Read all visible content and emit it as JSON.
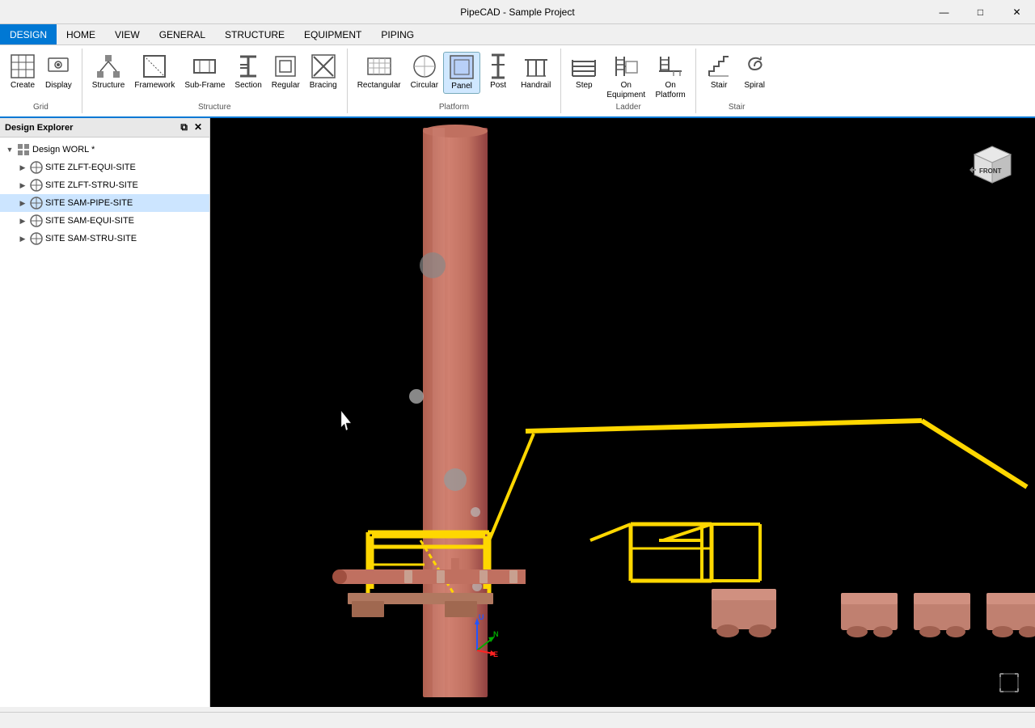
{
  "app": {
    "title": "PipeCAD - Sample Project"
  },
  "window_controls": {
    "minimize": "—",
    "maximize": "□",
    "close": "✕"
  },
  "menu_bar": {
    "items": [
      {
        "id": "design",
        "label": "DESIGN",
        "active": true
      },
      {
        "id": "home",
        "label": "HOME"
      },
      {
        "id": "view",
        "label": "VIEW"
      },
      {
        "id": "general",
        "label": "GENERAL"
      },
      {
        "id": "structure",
        "label": "STRUCTURE"
      },
      {
        "id": "equipment",
        "label": "EQUIPMENT"
      },
      {
        "id": "piping",
        "label": "PIPING"
      }
    ]
  },
  "ribbon": {
    "groups": [
      {
        "id": "grid",
        "label": "Grid",
        "items": [
          {
            "id": "create",
            "label": "Create",
            "icon": "⊞"
          },
          {
            "id": "display",
            "label": "Display",
            "icon": "◉"
          }
        ]
      },
      {
        "id": "structure",
        "label": "Structure",
        "items": [
          {
            "id": "structure-btn",
            "label": "Structure",
            "icon": "🏗"
          },
          {
            "id": "framework",
            "label": "Framework",
            "icon": "⬜"
          },
          {
            "id": "sub-frame",
            "label": "Sub-Frame",
            "icon": "▭"
          },
          {
            "id": "section",
            "label": "Section",
            "icon": "Ξ"
          },
          {
            "id": "regular",
            "label": "Regular",
            "icon": "◇"
          },
          {
            "id": "bracing",
            "label": "Bracing",
            "icon": "✕"
          }
        ]
      },
      {
        "id": "platform",
        "label": "Platform",
        "items": [
          {
            "id": "rectangular",
            "label": "Rectangular",
            "icon": "▭"
          },
          {
            "id": "circular",
            "label": "Circular",
            "icon": "○"
          },
          {
            "id": "panel",
            "label": "Panel",
            "icon": "▣"
          },
          {
            "id": "post",
            "label": "Post",
            "icon": "⋮"
          },
          {
            "id": "handrail",
            "label": "Handrail",
            "icon": "⊓"
          }
        ]
      },
      {
        "id": "ladder",
        "label": "Ladder",
        "items": [
          {
            "id": "step",
            "label": "Step",
            "icon": "⊏"
          },
          {
            "id": "on-equipment",
            "label": "On\nEquipment",
            "icon": "⊑"
          },
          {
            "id": "on-platform",
            "label": "On\nPlatform",
            "icon": "⊒"
          }
        ]
      },
      {
        "id": "stair",
        "label": "Stair",
        "items": [
          {
            "id": "stair-btn",
            "label": "Stair",
            "icon": "⌐"
          },
          {
            "id": "spiral",
            "label": "Spiral",
            "icon": "↺"
          }
        ]
      }
    ]
  },
  "design_explorer": {
    "title": "Design Explorer",
    "controls": [
      "⧉",
      "✕"
    ],
    "tree": [
      {
        "id": "design-worl",
        "label": "Design WORL *",
        "level": 0,
        "expanded": true,
        "type": "design",
        "selected": false
      },
      {
        "id": "site-zlft-equi",
        "label": "SITE ZLFT-EQUI-SITE",
        "level": 1,
        "expanded": false,
        "type": "site",
        "selected": false
      },
      {
        "id": "site-zlft-stru",
        "label": "SITE ZLFT-STRU-SITE",
        "level": 1,
        "expanded": false,
        "type": "site",
        "selected": false
      },
      {
        "id": "site-sam-pipe",
        "label": "SITE SAM-PIPE-SITE",
        "level": 1,
        "expanded": false,
        "type": "site",
        "selected": true
      },
      {
        "id": "site-sam-equi",
        "label": "SITE SAM-EQUI-SITE",
        "level": 1,
        "expanded": false,
        "type": "site",
        "selected": false
      },
      {
        "id": "site-sam-stru",
        "label": "SITE SAM-STRU-SITE",
        "level": 1,
        "expanded": false,
        "type": "site",
        "selected": false
      }
    ]
  },
  "viewport": {
    "background": "#000000",
    "axes": {
      "u_label": "U",
      "n_label": "N",
      "e_label": "E"
    },
    "cube_face": "FRONT"
  },
  "status_bar": {
    "text": ""
  }
}
